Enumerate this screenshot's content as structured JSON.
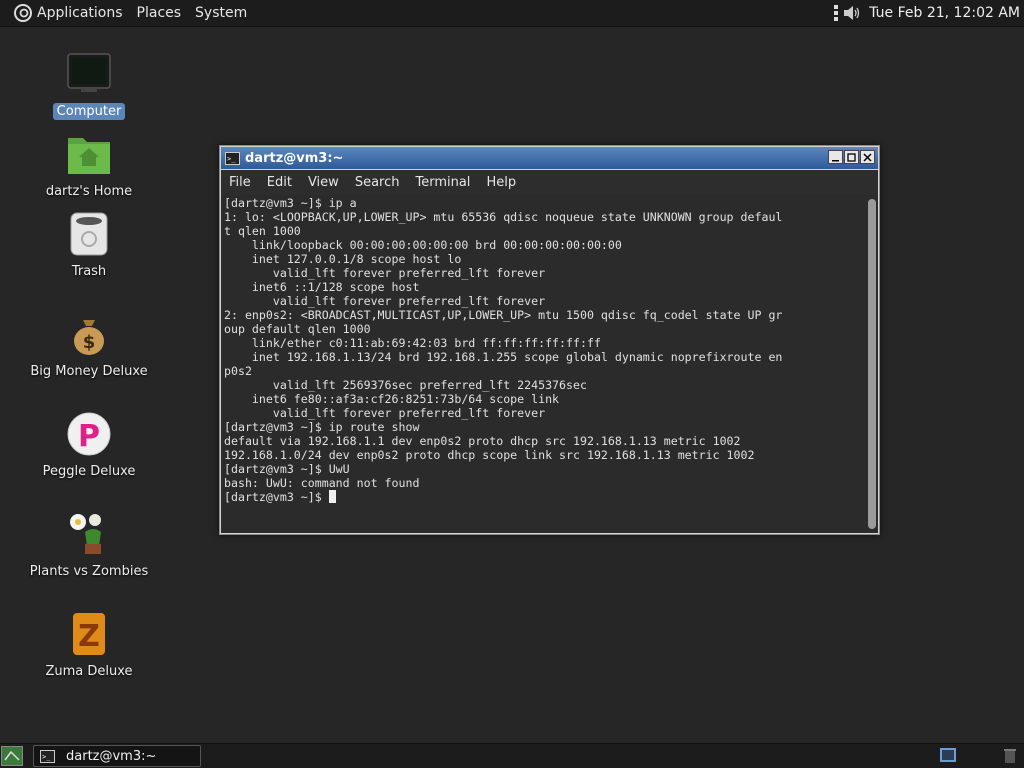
{
  "top_panel": {
    "menus": [
      "Applications",
      "Places",
      "System"
    ],
    "clock": "Tue Feb 21, 12:02 AM",
    "tray_icons": [
      "network-icon",
      "volume-icon"
    ]
  },
  "desktop": {
    "icons": [
      {
        "label": "Computer",
        "icon": "computer-icon",
        "selected": true
      },
      {
        "label": "dartz's Home",
        "icon": "home-folder-icon"
      },
      {
        "label": "Trash",
        "icon": "trash-icon"
      },
      {
        "label": "Big Money Deluxe",
        "icon": "money-bag-icon"
      },
      {
        "label": "Peggle Deluxe",
        "icon": "peggle-icon"
      },
      {
        "label": "Plants vs Zombies",
        "icon": "plants-vs-zombies-icon"
      },
      {
        "label": "Zuma Deluxe",
        "icon": "zuma-icon"
      }
    ]
  },
  "terminal": {
    "title": "dartz@vm3:~",
    "menus": [
      "File",
      "Edit",
      "View",
      "Search",
      "Terminal",
      "Help"
    ],
    "lines": [
      "[dartz@vm3 ~]$ ip a",
      "1: lo: <LOOPBACK,UP,LOWER_UP> mtu 65536 qdisc noqueue state UNKNOWN group defaul",
      "t qlen 1000",
      "    link/loopback 00:00:00:00:00:00 brd 00:00:00:00:00:00",
      "    inet 127.0.0.1/8 scope host lo",
      "       valid_lft forever preferred_lft forever",
      "    inet6 ::1/128 scope host",
      "       valid_lft forever preferred_lft forever",
      "2: enp0s2: <BROADCAST,MULTICAST,UP,LOWER_UP> mtu 1500 qdisc fq_codel state UP gr",
      "oup default qlen 1000",
      "    link/ether c0:11:ab:69:42:03 brd ff:ff:ff:ff:ff:ff",
      "    inet 192.168.1.13/24 brd 192.168.1.255 scope global dynamic noprefixroute en",
      "p0s2",
      "       valid_lft 2569376sec preferred_lft 2245376sec",
      "    inet6 fe80::af3a:cf26:8251:73b/64 scope link",
      "       valid_lft forever preferred_lft forever",
      "[dartz@vm3 ~]$ ip route show",
      "default via 192.168.1.1 dev enp0s2 proto dhcp src 192.168.1.13 metric 1002",
      "192.168.1.0/24 dev enp0s2 proto dhcp scope link src 192.168.1.13 metric 1002",
      "[dartz@vm3 ~]$ UwU",
      "bash: UwU: command not found"
    ],
    "prompt": "[dartz@vm3 ~]$ "
  },
  "taskbar": {
    "task_label": "dartz@vm3:~"
  }
}
